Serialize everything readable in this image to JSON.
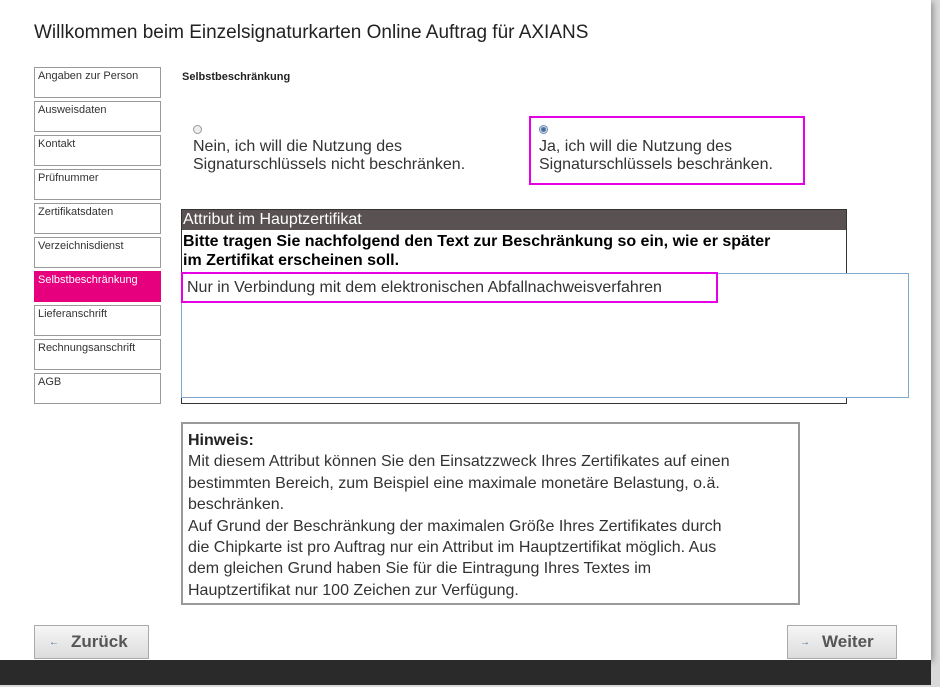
{
  "title": "Willkommen beim Einzelsignaturkarten Online Auftrag für AXIANS",
  "sidebar": {
    "items": [
      {
        "label": "Angaben zur Person"
      },
      {
        "label": "Ausweisdaten"
      },
      {
        "label": "Kontakt"
      },
      {
        "label": "Prüfnummer"
      },
      {
        "label": "Zertifikatsdaten"
      },
      {
        "label": "Verzeichnisdienst"
      },
      {
        "label": "Selbstbeschränkung"
      },
      {
        "label": "Lieferanschrift"
      },
      {
        "label": "Rechnungsanschrift"
      },
      {
        "label": "AGB"
      }
    ],
    "active_label": "Selbstbeschränkung"
  },
  "section": {
    "title": "Selbstbeschränkung",
    "option_no": {
      "line1": "Nein, ich will die Nutzung des",
      "line2": "Signaturschlüssels nicht beschränken."
    },
    "option_yes": {
      "line1": "Ja, ich will die Nutzung des",
      "line2": "Signaturschlüssels beschränken."
    }
  },
  "attribute": {
    "header": "Attribut im Hauptzertifikat",
    "instruction_line1": "Bitte tragen Sie nachfolgend den Text zur Beschränkung so ein, wie er später",
    "instruction_line2": "im Zertifikat erscheinen soll.",
    "value": "Nur in Verbindung mit dem elektronischen Abfallnachweisverfahren"
  },
  "hint": {
    "title": "Hinweis:",
    "line1": "Mit diesem Attribut können Sie den Einsatzzweck Ihres Zertifikates auf einen",
    "line2": "bestimmten Bereich, zum Beispiel eine maximale monetäre Belastung, o.ä.",
    "line3": "beschränken.",
    "line4": "Auf Grund der Beschränkung der maximalen Größe Ihres Zertifikates durch",
    "line5": "die Chipkarte ist pro Auftrag nur ein Attribut im Hauptzertifikat möglich. Aus",
    "line6": "dem gleichen Grund haben Sie für die Eintragung Ihres Textes im",
    "line7": "Hauptzertifikat nur 100 Zeichen zur Verfügung."
  },
  "buttons": {
    "back": "Zurück",
    "next": "Weiter"
  },
  "colors": {
    "accent": "#e6007e",
    "highlight": "#e600e6",
    "header_bg": "#5a5252"
  }
}
